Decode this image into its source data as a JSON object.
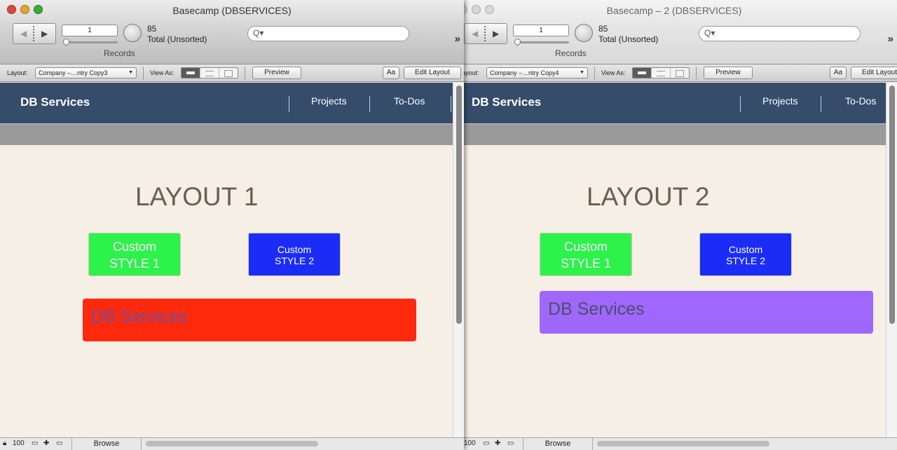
{
  "windows": [
    {
      "title": "Basecamp (DBSERVICES)",
      "record_number": "1",
      "record_total": "85",
      "record_status": "Total (Unsorted)",
      "records_label": "Records",
      "search_icon": "Q▾",
      "more_chevrons": "»",
      "layout_label": "Layout:",
      "layout_select": "Company –…ntry Copy3",
      "view_as_label": "View As:",
      "preview_button": "Preview",
      "font_button": "Aa",
      "edit_layout_button": "Edit Layout",
      "brand": "DB Services",
      "nav": [
        "Projects",
        "To-Dos"
      ],
      "layout_title": "LAYOUT 1",
      "style1_line1": "Custom",
      "style1_line2": "STYLE 1",
      "style2_line1": "Custom",
      "style2_line2": "STYLE 2",
      "banner_text": "DB Services",
      "banner_color": "#ff2a0e",
      "zoom": "100",
      "mode": "Browse"
    },
    {
      "title": "Basecamp – 2 (DBSERVICES)",
      "record_number": "1",
      "record_total": "85",
      "record_status": "Total (Unsorted)",
      "records_label": "Records",
      "search_icon": "Q▾",
      "more_chevrons": "»",
      "layout_label": "Layout:",
      "layout_select": "Company –…ntry Copy4",
      "view_as_label": "View As:",
      "preview_button": "Preview",
      "font_button": "Aa",
      "edit_layout_button": "Edit Layout",
      "brand": "DB Services",
      "nav": [
        "Projects",
        "To-Dos"
      ],
      "layout_title": "LAYOUT 2",
      "style1_line1": "Custom",
      "style1_line2": "STYLE 1",
      "style2_line1": "Custom",
      "style2_line2": "STYLE 2",
      "banner_text": "DB Services",
      "banner_color": "#9f67fb",
      "zoom": "100",
      "mode": "Browse"
    }
  ],
  "colors": {
    "header": "#354c6b",
    "style1": "#2cf24a",
    "style2": "#1c2cf7",
    "background": "#f5efe5"
  }
}
